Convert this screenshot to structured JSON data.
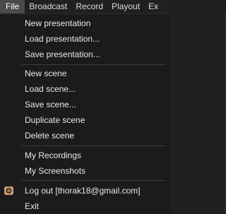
{
  "menubar": {
    "items": [
      {
        "label": "File",
        "active": true
      },
      {
        "label": "Broadcast",
        "active": false
      },
      {
        "label": "Record",
        "active": false
      },
      {
        "label": "Playout",
        "active": false
      },
      {
        "label": "Ex",
        "active": false
      }
    ]
  },
  "file_menu": {
    "new_presentation": "New presentation",
    "load_presentation": "Load presentation...",
    "save_presentation": "Save presentation...",
    "new_scene": "New scene",
    "load_scene": "Load scene...",
    "save_scene": "Save scene...",
    "duplicate_scene": "Duplicate scene",
    "delete_scene": "Delete scene",
    "my_recordings": "My Recordings",
    "my_screenshots": "My Screenshots",
    "log_out": "Log out [thorak18@gmail.com]",
    "exit": "Exit",
    "log_out_icon": "account-icon"
  },
  "colors": {
    "menubar_bg": "#202020",
    "active_item_bg": "#4a4a4a",
    "dropdown_bg": "#1b1b1b",
    "separator": "#3c3c3c",
    "icon_accent": "#c9a079"
  }
}
